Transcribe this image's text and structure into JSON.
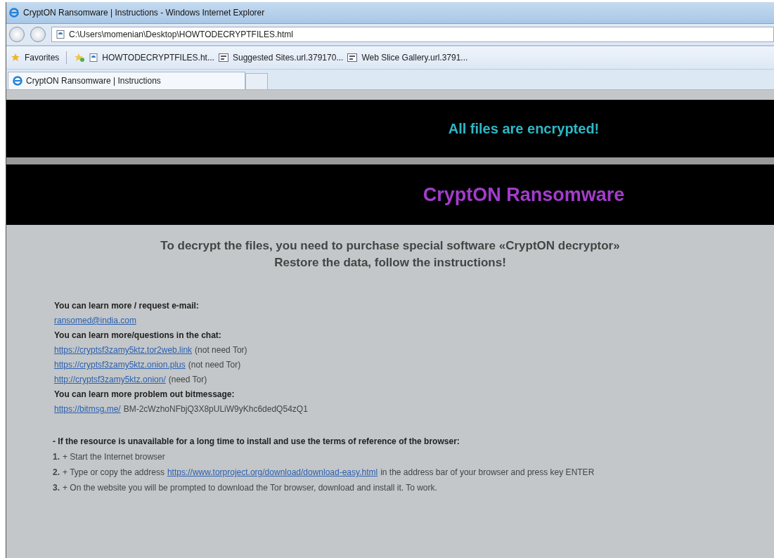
{
  "window": {
    "title": "CryptON Ransomware | Instructions - Windows Internet Explorer"
  },
  "address_bar": {
    "value": "C:\\Users\\momenian\\Desktop\\HOWTODECRYPTFILES.html"
  },
  "favorites_bar": {
    "label": "Favorites",
    "items": [
      {
        "label": "HOWTODECRYPTFILES.ht...",
        "kind": "page"
      },
      {
        "label": "Suggested Sites.url.379170...",
        "kind": "url"
      },
      {
        "label": "Web Slice Gallery.url.3791...",
        "kind": "url"
      }
    ]
  },
  "tabs": [
    {
      "label": "CryptON Ransomware | Instructions",
      "selected": true
    }
  ],
  "page": {
    "banner": "All files are encrypted!",
    "brand": "CryptON Ransomware",
    "headline": [
      "To decrypt the files, you need to purchase special software «CryptON decryptor»",
      "Restore the data, follow the instructions!"
    ],
    "contacts": [
      {
        "kind": "heading",
        "text": "You can learn more / request e-mail:"
      },
      {
        "kind": "link",
        "link": "ransomed@india.com"
      },
      {
        "kind": "heading",
        "text": "You can learn more/questions in the chat:"
      },
      {
        "kind": "link",
        "link": "https://cryptsf3zamy5ktz.tor2web.link",
        "note": "(not need Tor)"
      },
      {
        "kind": "link",
        "link": "https://cryptsf3zamy5ktz.onion.plus",
        "note": "(not need Tor)"
      },
      {
        "kind": "link",
        "link": "http://cryptsf3zamy5ktz.onion/",
        "note": "(need Tor)"
      },
      {
        "kind": "heading",
        "text": "You can learn more problem out bitmessage:"
      },
      {
        "kind": "link",
        "link": "https://bitmsg.me/",
        "note": "BM-2cWzhoNFbjQ3X8pULiW9yKhc6dedQ54zQ1"
      }
    ],
    "instructions_title": "- If the resource is unavailable for a long time to install and use the terms of reference of the browser:",
    "steps": [
      {
        "number": "1.",
        "before": "+ Start the Internet browser"
      },
      {
        "number": "2.",
        "before": "+ Type or copy the address",
        "link": "https://www.torproject.org/download/download-easy.html",
        "after": "in the address bar of your browser and press key ENTER"
      },
      {
        "number": "3.",
        "before": "+ On the website you will be prompted to download the Tor browser, download and install it. To work."
      }
    ]
  }
}
